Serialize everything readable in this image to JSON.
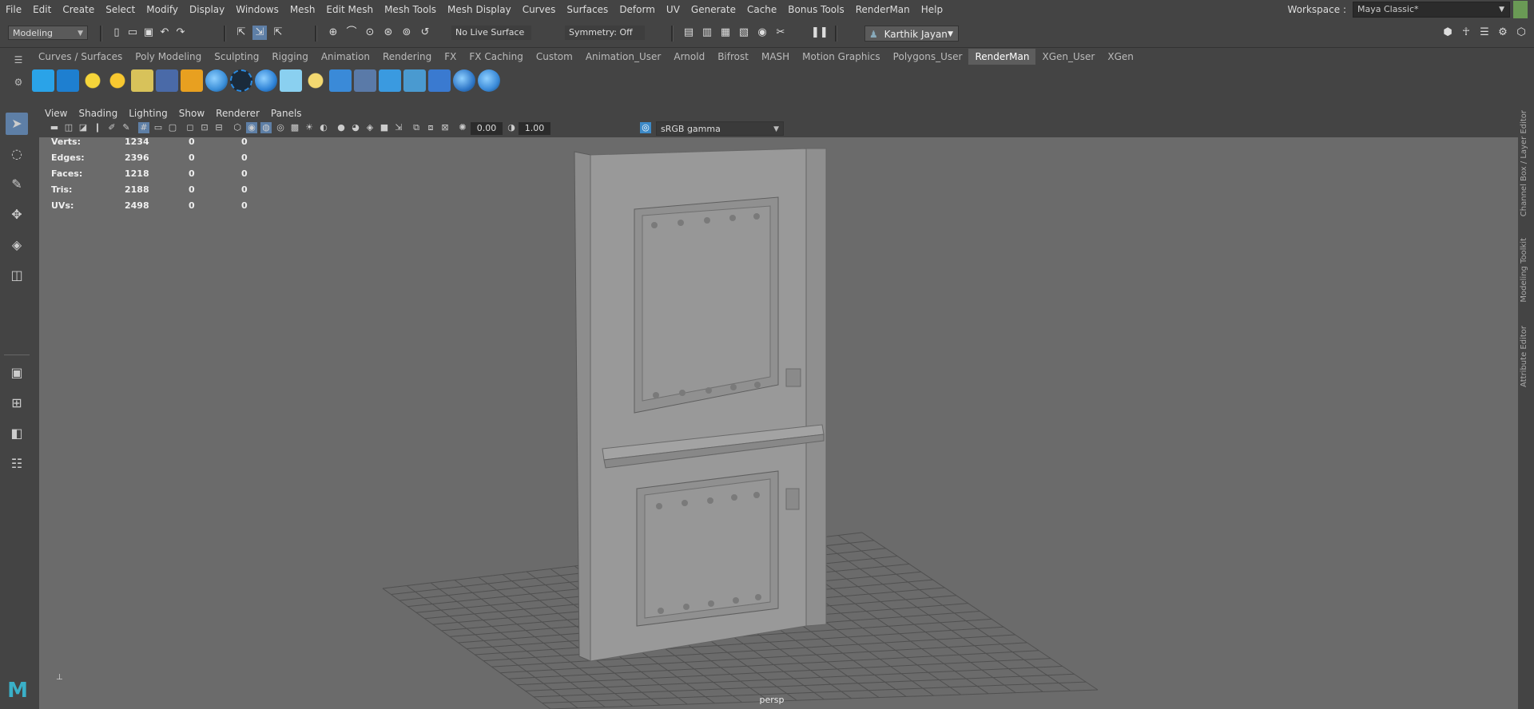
{
  "menubar": {
    "items": [
      "File",
      "Edit",
      "Create",
      "Select",
      "Modify",
      "Display",
      "Windows",
      "Mesh",
      "Edit Mesh",
      "Mesh Tools",
      "Mesh Display",
      "Curves",
      "Surfaces",
      "Deform",
      "UV",
      "Generate",
      "Cache",
      "Bonus Tools",
      "RenderMan",
      "Help"
    ]
  },
  "workspace": {
    "label": "Workspace :",
    "value": "Maya Classic*"
  },
  "statusline": {
    "mode": "Modeling",
    "live_surface": "No Live Surface",
    "symmetry": "Symmetry: Off",
    "user": "Karthik Jayan"
  },
  "shelf": {
    "tabs": [
      "Curves / Surfaces",
      "Poly Modeling",
      "Sculpting",
      "Rigging",
      "Animation",
      "Rendering",
      "FX",
      "FX Caching",
      "Custom",
      "Animation_User",
      "Arnold",
      "Bifrost",
      "MASH",
      "Motion Graphics",
      "Polygons_User",
      "RenderMan",
      "XGen_User",
      "XGen"
    ],
    "active_tab": "RenderMan",
    "icons": [
      "clapboard-icon",
      "ipr-render-icon",
      "point-light-icon",
      "sun-light-icon",
      "env-light-icon",
      "daylight-icon",
      "pxr-surface-icon",
      "material-sphere-icon",
      "volume-aggregate-icon",
      "info-icon",
      "eye-icon",
      "bulb-icon",
      "calculator-icon",
      "texture-manager-icon",
      "moon-icon",
      "image-tool-icon",
      "stats-chart-icon",
      "rfm-settings-icon",
      "help-icon"
    ],
    "icon_colors": [
      "#2aa3e8",
      "#1e7fd0",
      "#f5d53a",
      "#f8c830",
      "#d8c25a",
      "#4a6aa8",
      "#e8a020",
      "#3a8ed8",
      "#2a8ae0",
      "#2f83d7",
      "#8ad0f0",
      "#f3d870",
      "#3a8ad8",
      "#5a7aa8",
      "#3a9ae0",
      "#4a9ad0",
      "#3a7ad0",
      "#3078c8",
      "#3a8ad8"
    ]
  },
  "panel": {
    "menus": [
      "View",
      "Shading",
      "Lighting",
      "Show",
      "Renderer",
      "Panels"
    ],
    "exposure": "0.00",
    "gamma": "1.00",
    "colorspace": "sRGB gamma"
  },
  "hud": {
    "rows": [
      {
        "label": "Verts:",
        "v1": "1234",
        "v2": "0",
        "v3": "0"
      },
      {
        "label": "Edges:",
        "v1": "2396",
        "v2": "0",
        "v3": "0"
      },
      {
        "label": "Faces:",
        "v1": "1218",
        "v2": "0",
        "v3": "0"
      },
      {
        "label": "Tris:",
        "v1": "2188",
        "v2": "0",
        "v3": "0"
      },
      {
        "label": "UVs:",
        "v1": "2498",
        "v2": "0",
        "v3": "0"
      }
    ]
  },
  "viewport": {
    "camera": "persp"
  },
  "rightbar": {
    "tabs": [
      "Channel Box / Layer Editor",
      "Modeling Toolkit",
      "Attribute Editor"
    ]
  },
  "toolbox": {
    "tools": [
      "select-tool-icon",
      "lasso-tool-icon",
      "paint-select-icon",
      "move-tool-icon",
      "rotate-tool-icon",
      "scale-tool-icon",
      "layout-single-icon",
      "layout-four-icon",
      "layout-two-icon",
      "outliner-icon"
    ]
  }
}
